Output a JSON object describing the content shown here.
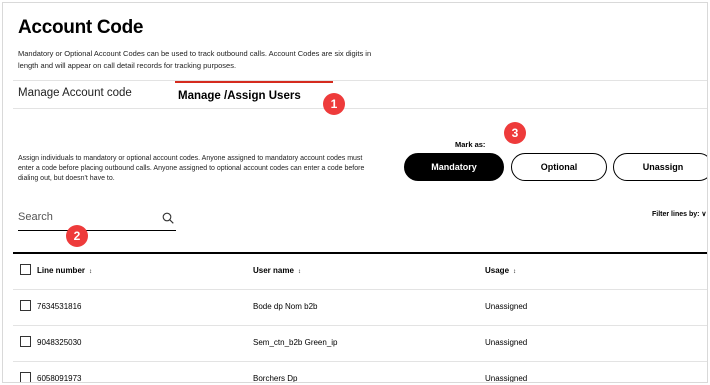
{
  "page": {
    "title": "Account Code",
    "description": "Mandatory or Optional Account Codes can be used to track outbound calls. Account Codes are six digits in length and will appear on call detail records for tracking purposes."
  },
  "tabs": [
    {
      "label": "Manage Account code",
      "active": false
    },
    {
      "label": "Manage /Assign Users",
      "active": true
    }
  ],
  "callouts": [
    "1",
    "2",
    "3"
  ],
  "assign_text": "Assign individuals to mandatory or optional account codes. Anyone assigned to mandatory account codes must enter a code before placing outbound calls. Anyone assigned to optional account codes can enter a code before dialing out, but doesn't have to.",
  "mark_as": {
    "label": "Mark as:",
    "buttons": [
      "Mandatory",
      "Optional",
      "Unassign"
    ]
  },
  "search": {
    "placeholder": "Search",
    "icon": "search-icon"
  },
  "filter": {
    "label": "Filter lines by:"
  },
  "table": {
    "headers": [
      "Line number",
      "User name",
      "Usage"
    ],
    "sort_glyph": "↕",
    "rows": [
      {
        "line": "7634531816",
        "user": "Bode dp Nom b2b",
        "usage": "Unassigned"
      },
      {
        "line": "9048325030",
        "user": "Sem_ctn_b2b Green_ip",
        "usage": "Unassigned"
      },
      {
        "line": "6058091973",
        "user": "Borchers Dp",
        "usage": "Unassigned"
      }
    ]
  },
  "colors": {
    "accent": "#d52b1e",
    "callout": "#ee3b3b",
    "primary": "#000000"
  }
}
